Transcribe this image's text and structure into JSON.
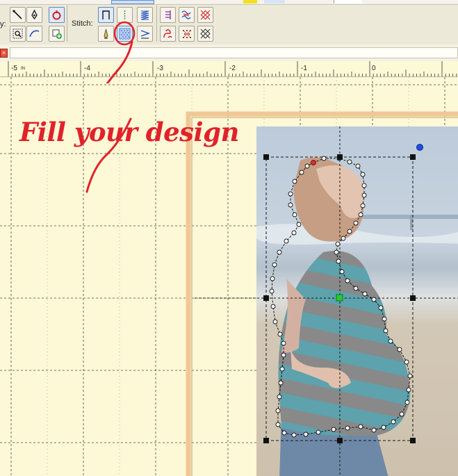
{
  "toolbar": {
    "partial_label": "y:",
    "stitch_label": "Stitch:",
    "tools": [
      {
        "name": "line-tool",
        "selected": false
      },
      {
        "name": "pen-node-tool",
        "selected": false
      },
      {
        "name": "red-circle-tool",
        "selected": true
      },
      {
        "name": "zoom-select-tool",
        "selected": false
      },
      {
        "name": "curve-tool",
        "selected": false
      },
      {
        "name": "add-point-tool",
        "selected": false
      }
    ],
    "stitch_tools": [
      {
        "name": "run-stitch",
        "selected": true
      },
      {
        "name": "triple-stitch",
        "selected": false
      },
      {
        "name": "satin-stitch",
        "selected": false
      },
      {
        "name": "applique-stitch",
        "selected": false
      },
      {
        "name": "fill-stitch",
        "selected": true
      },
      {
        "name": "satin-column-stitch",
        "selected": false
      },
      {
        "name": "motif-stitch-1",
        "selected": false
      },
      {
        "name": "motif-stitch-2",
        "selected": false
      },
      {
        "name": "motif-stitch-3",
        "selected": false
      },
      {
        "name": "motif-stitch-4",
        "selected": false
      },
      {
        "name": "motif-stitch-5",
        "selected": false
      },
      {
        "name": "cross-stitch",
        "selected": false
      }
    ]
  },
  "tab": {
    "close_glyph": "×"
  },
  "ruler": {
    "unit_label": "IN",
    "labels": [
      "-5",
      "-4",
      "-3",
      "-2",
      "-1",
      "0"
    ]
  },
  "annotation": {
    "text": "Fill your design",
    "color": "#e0222b"
  },
  "colors": {
    "canvas": "#fdf8d6",
    "hoop": "#f0c896",
    "accent_selected": "#5c86c2",
    "node_start": "#d9302a",
    "node_center": "#27c93a",
    "handle_rotate": "#1f4fe0"
  }
}
